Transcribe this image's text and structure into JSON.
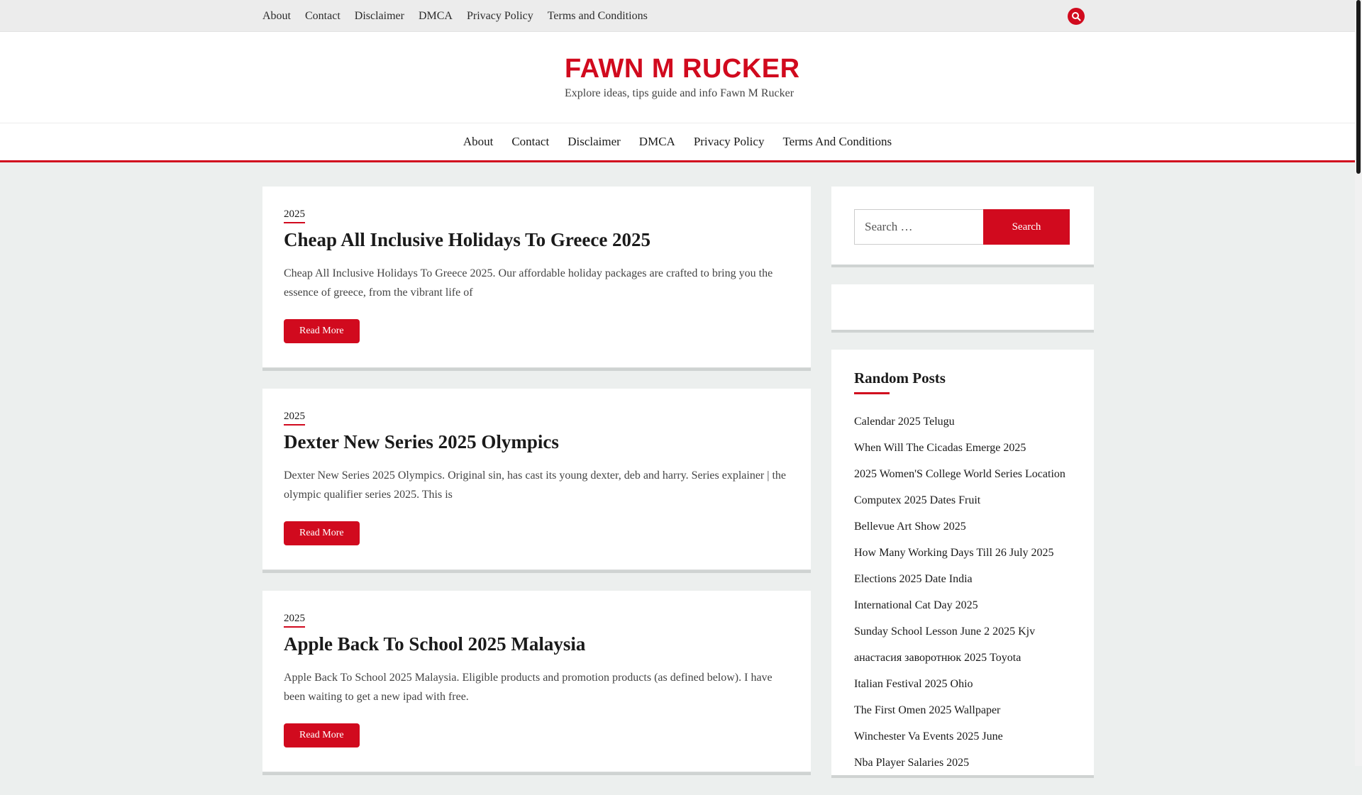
{
  "topbar": {
    "links": [
      "About",
      "Contact",
      "Disclaimer",
      "DMCA",
      "Privacy Policy",
      "Terms and Conditions"
    ],
    "search_icon": "search-icon"
  },
  "header": {
    "title": "FAWN M RUCKER",
    "tagline": "Explore ideas, tips guide and info Fawn M Rucker"
  },
  "mainnav": {
    "links": [
      "About",
      "Contact",
      "Disclaimer",
      "DMCA",
      "Privacy Policy",
      "Terms And Conditions"
    ]
  },
  "posts": [
    {
      "category": "2025",
      "title": "Cheap All Inclusive Holidays To Greece 2025",
      "excerpt": "Cheap All Inclusive Holidays To Greece 2025. Our affordable holiday packages are crafted to bring you the essence of greece, from the vibrant life of",
      "read_more": "Read More"
    },
    {
      "category": "2025",
      "title": "Dexter New Series 2025 Olympics",
      "excerpt": "Dexter New Series 2025 Olympics. Original sin, has cast its young dexter, deb and harry. Series explainer | the olympic qualifier series 2025. This is",
      "read_more": "Read More"
    },
    {
      "category": "2025",
      "title": "Apple Back To School 2025 Malaysia",
      "excerpt": "Apple Back To School 2025 Malaysia. Eligible products and promotion products (as defined below). I have been waiting to get a new ipad with free.",
      "read_more": "Read More"
    }
  ],
  "sidebar": {
    "search": {
      "placeholder": "Search …",
      "button": "Search"
    },
    "random_posts": {
      "title": "Random Posts",
      "items": [
        "Calendar 2025 Telugu",
        "When Will The Cicadas Emerge 2025",
        "2025 Women'S College World Series Location",
        "Computex 2025 Dates Fruit",
        "Bellevue Art Show 2025",
        "How Many Working Days Till 26 July 2025",
        "Elections 2025 Date India",
        "International Cat Day 2025",
        "Sunday School Lesson June 2 2025 Kjv",
        "анастасия заворотнюк 2025 Toyota",
        "Italian Festival 2025 Ohio",
        "The First Omen 2025 Wallpaper",
        "Winchester Va Events 2025 June",
        "Nba Player Salaries 2025"
      ]
    }
  },
  "colors": {
    "accent": "#d10a1e",
    "background": "#ecefee"
  }
}
